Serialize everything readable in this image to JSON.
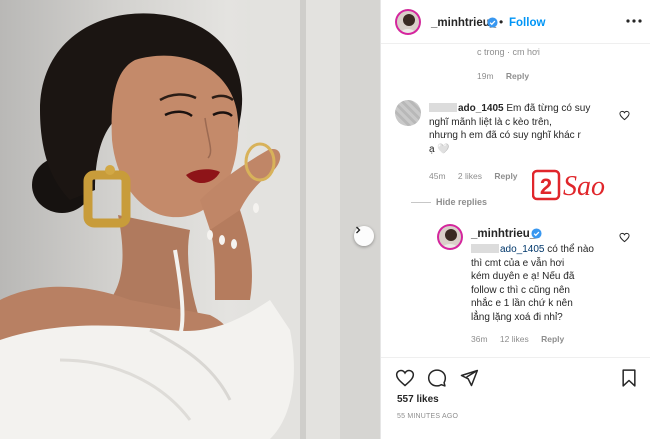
{
  "post": {
    "username": "_minhtrieu_",
    "follow_label": "Follow",
    "separator": "•",
    "likes": "557 likes",
    "time_ago": "55 MINUTES AGO"
  },
  "comments": {
    "top_partial": {
      "text_fragment": "c trong · cm hơi",
      "time": "19m",
      "reply_label": "Reply"
    },
    "first": {
      "username": "ado_1405",
      "lines": [
        "Em đã từng có suy",
        "nghĩ mãnh liệt là c kèo trên,",
        "nhưng h em đã có suy nghĩ khác r",
        "ạ 🤍"
      ],
      "time": "45m",
      "likes": "2 likes",
      "reply_label": "Reply"
    },
    "hide_replies_label": "Hide replies",
    "reply": {
      "username": "_minhtrieu_",
      "mention": "ado_1405",
      "lines": [
        "có thể nào",
        "thì cmt của e vẫn hơi",
        "kém duyên e ạ! Nếu đã",
        "follow c thì c cũng nên",
        "nhắc e 1 lần chứ k nên",
        "lẳng lặng xoá đi nhỉ?"
      ],
      "time": "36m",
      "likes": "12 likes",
      "reply_label": "Reply"
    }
  },
  "watermark": {
    "digit": "2",
    "word": "Sao"
  },
  "colors": {
    "link_blue": "#0095f6",
    "verified_blue": "#3897f0",
    "meta_gray": "#8e8e8e",
    "watermark_red": "#e0262b"
  },
  "icons": [
    "more-options-icon",
    "verified-badge-icon",
    "heart-icon",
    "comment-icon",
    "share-icon",
    "bookmark-icon",
    "next-arrow-icon"
  ]
}
